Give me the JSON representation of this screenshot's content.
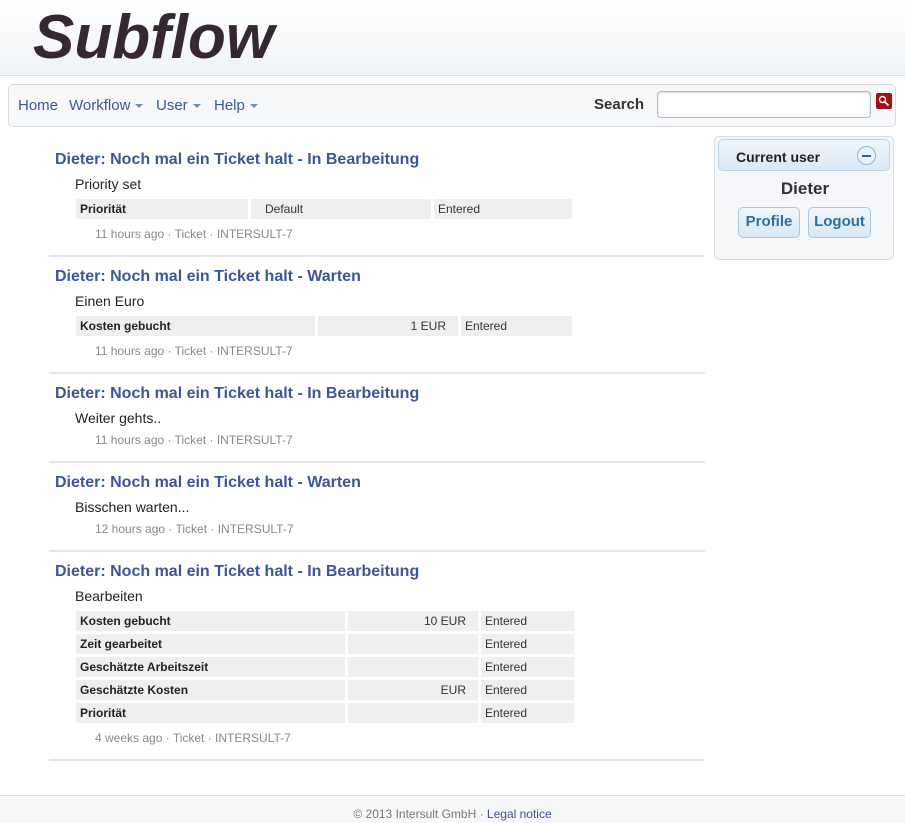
{
  "app": {
    "title": "Subflow"
  },
  "nav": {
    "items": [
      {
        "label": "Home",
        "dropdown": false
      },
      {
        "label": "Workflow",
        "dropdown": true
      },
      {
        "label": "User",
        "dropdown": true
      },
      {
        "label": "Help",
        "dropdown": true
      }
    ],
    "search_label": "Search",
    "search_value": "",
    "search_placeholder": ""
  },
  "feed": [
    {
      "title": "Dieter: Noch mal ein Ticket halt - In Bearbeitung",
      "text": "Priority set",
      "fields": [
        {
          "name": "Priorität",
          "value": "Default",
          "status": "Entered"
        }
      ],
      "meta": "11 hours ago · Ticket · INTERSULT-7"
    },
    {
      "title": "Dieter: Noch mal ein Ticket halt - Warten",
      "text": "Einen Euro",
      "fields": [
        {
          "name": "Kosten gebucht",
          "value": "1 EUR",
          "status": "Entered"
        }
      ],
      "meta": "11 hours ago · Ticket · INTERSULT-7"
    },
    {
      "title": "Dieter: Noch mal ein Ticket halt - In Bearbeitung",
      "text": "Weiter gehts..",
      "fields": [],
      "meta": "11 hours ago · Ticket · INTERSULT-7"
    },
    {
      "title": "Dieter: Noch mal ein Ticket halt - Warten",
      "text": "Bisschen warten...",
      "fields": [],
      "meta": "12 hours ago · Ticket · INTERSULT-7"
    },
    {
      "title": "Dieter: Noch mal ein Ticket halt - In Bearbeitung",
      "text": "Bearbeiten",
      "fields": [
        {
          "name": "Kosten gebucht",
          "value": "10 EUR",
          "status": "Entered"
        },
        {
          "name": "Zeit gearbeitet",
          "value": "",
          "status": "Entered"
        },
        {
          "name": "Geschätzte Arbeitszeit",
          "value": "",
          "status": "Entered"
        },
        {
          "name": "Geschätzte Kosten",
          "value": "EUR",
          "status": "Entered"
        },
        {
          "name": "Priorität",
          "value": "",
          "status": "Entered"
        }
      ],
      "meta": "4 weeks ago · Ticket · INTERSULT-7"
    }
  ],
  "sidebar": {
    "title": "Current user",
    "username": "Dieter",
    "profile_label": "Profile",
    "logout_label": "Logout"
  },
  "footer": {
    "copyright": "© 2013 Intersult GmbH · ",
    "legal_label": "Legal notice"
  },
  "colors": {
    "link": "#3a5898",
    "accent": "#a50f12",
    "logo": "#352832"
  }
}
